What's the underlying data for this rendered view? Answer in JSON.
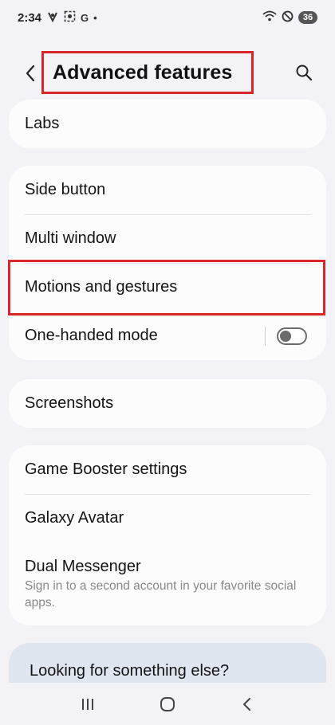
{
  "status_bar": {
    "time": "2:34",
    "left_icons": [
      "voicemail-icon",
      "screen-capture-icon"
    ],
    "google_letter": "G",
    "dot": "•",
    "battery": "36"
  },
  "header": {
    "title": "Advanced features"
  },
  "cards": {
    "labs": {
      "label": "Labs"
    },
    "group1": {
      "side_button": "Side button",
      "multi_window": "Multi window",
      "motions_gestures": "Motions and gestures",
      "one_handed_mode": "One-handed mode",
      "one_handed_enabled": false
    },
    "screenshots": {
      "label": "Screenshots"
    },
    "group2": {
      "game_booster": "Game Booster settings",
      "galaxy_avatar": "Galaxy Avatar",
      "dual_messenger": "Dual Messenger",
      "dual_messenger_sub": "Sign in to a second account in your favorite social apps."
    }
  },
  "looking": {
    "label": "Looking for something else?"
  },
  "colors": {
    "highlight": "#d9262c",
    "background": "#f2f2f7",
    "card": "#fcfcfc"
  },
  "nav": {
    "buttons": [
      "recents-icon",
      "home-icon",
      "back-icon"
    ]
  }
}
